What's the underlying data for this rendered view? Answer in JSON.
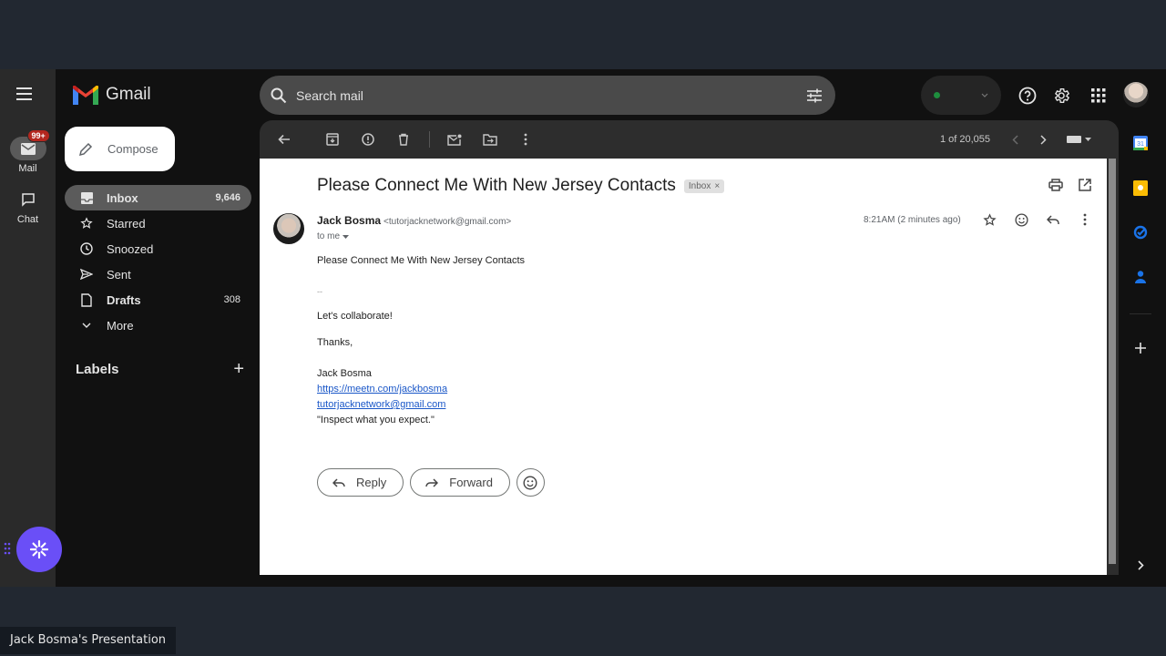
{
  "app": {
    "name": "Gmail"
  },
  "rail": {
    "items": [
      {
        "label": "Mail",
        "badge": "99+",
        "icon": "mail-icon",
        "active": true
      },
      {
        "label": "Chat",
        "icon": "chat-icon",
        "active": false
      }
    ]
  },
  "compose": {
    "label": "Compose"
  },
  "nav": {
    "items": [
      {
        "label": "Inbox",
        "count": "9,646",
        "icon": "inbox-icon"
      },
      {
        "label": "Starred",
        "count": "",
        "icon": "star-icon"
      },
      {
        "label": "Snoozed",
        "count": "",
        "icon": "clock-icon"
      },
      {
        "label": "Sent",
        "count": "",
        "icon": "send-icon"
      },
      {
        "label": "Drafts",
        "count": "308",
        "icon": "draft-icon"
      },
      {
        "label": "More",
        "count": "",
        "icon": "chevron-down-icon"
      }
    ],
    "labels_header": "Labels",
    "labels_add": "+"
  },
  "search": {
    "placeholder": "Search mail"
  },
  "toolbar": {
    "pager": "1 of 20,055"
  },
  "message": {
    "subject": "Please Connect Me With New Jersey Contacts",
    "label_chip": "Inbox",
    "chip_close": "×",
    "sender_name": "Jack Bosma",
    "sender_email": "<tutorjacknetwork@gmail.com>",
    "to": "to me",
    "time": "8:21AM (2 minutes ago)",
    "body": {
      "line1": "Please Connect Me With New Jersey Contacts",
      "separator": "--",
      "line2": "Let's collaborate!",
      "line3": "Thanks,",
      "sig_name": "Jack Bosma",
      "sig_link": "https://meetn.com/jackbosma",
      "sig_email": "tutorjacknetwork@gmail.com",
      "sig_quote": "\"Inspect what you expect.\""
    },
    "reply_label": "Reply",
    "forward_label": "Forward"
  },
  "side_apps": [
    "calendar",
    "keep",
    "tasks",
    "contacts"
  ],
  "side_calendar_day": "31",
  "caption": "Jack Bosma's Presentation",
  "colors": {
    "accent_fab": "#6a4ff7",
    "badge": "#b3261e",
    "link": "#1a57c8",
    "status_dot": "#1e8e3e"
  }
}
